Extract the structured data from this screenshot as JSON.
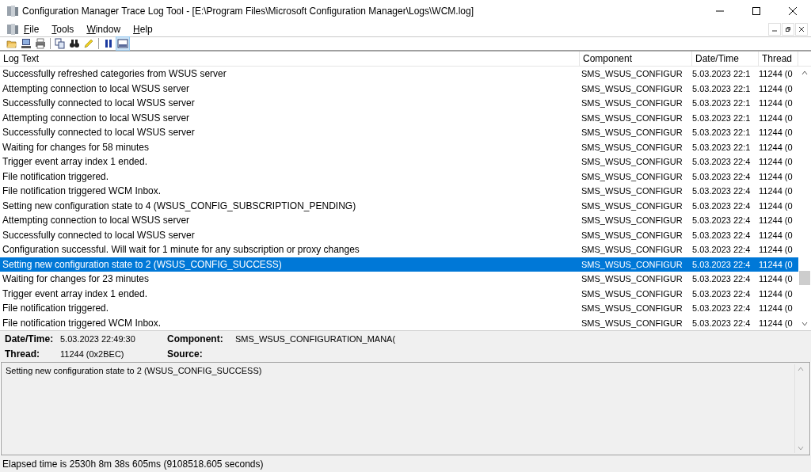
{
  "window": {
    "title": "Configuration Manager Trace Log Tool - [E:\\Program Files\\Microsoft Configuration Manager\\Logs\\WCM.log]"
  },
  "menu": [
    "File",
    "Tools",
    "Window",
    "Help"
  ],
  "toolbar": [
    {
      "kind": "open"
    },
    {
      "kind": "computer"
    },
    {
      "kind": "print"
    },
    {
      "kind": "sep"
    },
    {
      "kind": "copy"
    },
    {
      "kind": "find"
    },
    {
      "kind": "highlight"
    },
    {
      "kind": "sep"
    },
    {
      "kind": "pause",
      "selected": false
    },
    {
      "kind": "panel",
      "selected": true
    }
  ],
  "table": {
    "columns": [
      "Log Text",
      "Component",
      "Date/Time",
      "Thread"
    ],
    "rows": [
      {
        "text": "Successfully refreshed categories from WSUS server",
        "component": "SMS_WSUS_CONFIGUR",
        "datetime": "5.03.2023 22:1",
        "thread": "11244 (0",
        "selected": false
      },
      {
        "text": "Attempting connection to local WSUS server",
        "component": "SMS_WSUS_CONFIGUR",
        "datetime": "5.03.2023 22:1",
        "thread": "11244 (0",
        "selected": false
      },
      {
        "text": "Successfully connected to local WSUS server",
        "component": "SMS_WSUS_CONFIGUR",
        "datetime": "5.03.2023 22:1",
        "thread": "11244 (0",
        "selected": false
      },
      {
        "text": "Attempting connection to local WSUS server",
        "component": "SMS_WSUS_CONFIGUR",
        "datetime": "5.03.2023 22:1",
        "thread": "11244 (0",
        "selected": false
      },
      {
        "text": "Successfully connected to local WSUS server",
        "component": "SMS_WSUS_CONFIGUR",
        "datetime": "5.03.2023 22:1",
        "thread": "11244 (0",
        "selected": false
      },
      {
        "text": "Waiting for changes for 58 minutes",
        "component": "SMS_WSUS_CONFIGUR",
        "datetime": "5.03.2023 22:1",
        "thread": "11244 (0",
        "selected": false
      },
      {
        "text": "Trigger event array index 1 ended.",
        "component": "SMS_WSUS_CONFIGUR",
        "datetime": "5.03.2023 22:4",
        "thread": "11244 (0",
        "selected": false
      },
      {
        "text": "File notification triggered.",
        "component": "SMS_WSUS_CONFIGUR",
        "datetime": "5.03.2023 22:4",
        "thread": "11244 (0",
        "selected": false
      },
      {
        "text": "File notification triggered WCM Inbox.",
        "component": "SMS_WSUS_CONFIGUR",
        "datetime": "5.03.2023 22:4",
        "thread": "11244 (0",
        "selected": false
      },
      {
        "text": "Setting new configuration state to 4 (WSUS_CONFIG_SUBSCRIPTION_PENDING)",
        "component": "SMS_WSUS_CONFIGUR",
        "datetime": "5.03.2023 22:4",
        "thread": "11244 (0",
        "selected": false
      },
      {
        "text": "Attempting connection to local WSUS server",
        "component": "SMS_WSUS_CONFIGUR",
        "datetime": "5.03.2023 22:4",
        "thread": "11244 (0",
        "selected": false
      },
      {
        "text": "Successfully connected to local WSUS server",
        "component": "SMS_WSUS_CONFIGUR",
        "datetime": "5.03.2023 22:4",
        "thread": "11244 (0",
        "selected": false
      },
      {
        "text": "Configuration successful. Will wait for 1 minute for any subscription or proxy changes",
        "component": "SMS_WSUS_CONFIGUR",
        "datetime": "5.03.2023 22:4",
        "thread": "11244 (0",
        "selected": false
      },
      {
        "text": "Setting new configuration state to 2 (WSUS_CONFIG_SUCCESS)",
        "component": "SMS_WSUS_CONFIGUR",
        "datetime": "5.03.2023 22:4",
        "thread": "11244 (0",
        "selected": true
      },
      {
        "text": "Waiting for changes for 23 minutes",
        "component": "SMS_WSUS_CONFIGUR",
        "datetime": "5.03.2023 22:4",
        "thread": "11244 (0",
        "selected": false
      },
      {
        "text": "Trigger event array index 1 ended.",
        "component": "SMS_WSUS_CONFIGUR",
        "datetime": "5.03.2023 22:4",
        "thread": "11244 (0",
        "selected": false
      },
      {
        "text": "File notification triggered.",
        "component": "SMS_WSUS_CONFIGUR",
        "datetime": "5.03.2023 22:4",
        "thread": "11244 (0",
        "selected": false
      },
      {
        "text": "File notification triggered WCM Inbox.",
        "component": "SMS_WSUS_CONFIGUR",
        "datetime": "5.03.2023 22:4",
        "thread": "11244 (0",
        "selected": false
      }
    ]
  },
  "details": {
    "datetime_label": "Date/Time:",
    "datetime": "5.03.2023 22:49:30",
    "thread_label": "Thread:",
    "thread": "11244 (0x2BEC)",
    "component_label": "Component:",
    "component": "SMS_WSUS_CONFIGURATION_MANA(",
    "source_label": "Source:"
  },
  "message": "Setting new configuration state to 2 (WSUS_CONFIG_SUCCESS)",
  "status_bar": "Elapsed time is 2530h 8m 38s 605ms (9108518.605 seconds)"
}
